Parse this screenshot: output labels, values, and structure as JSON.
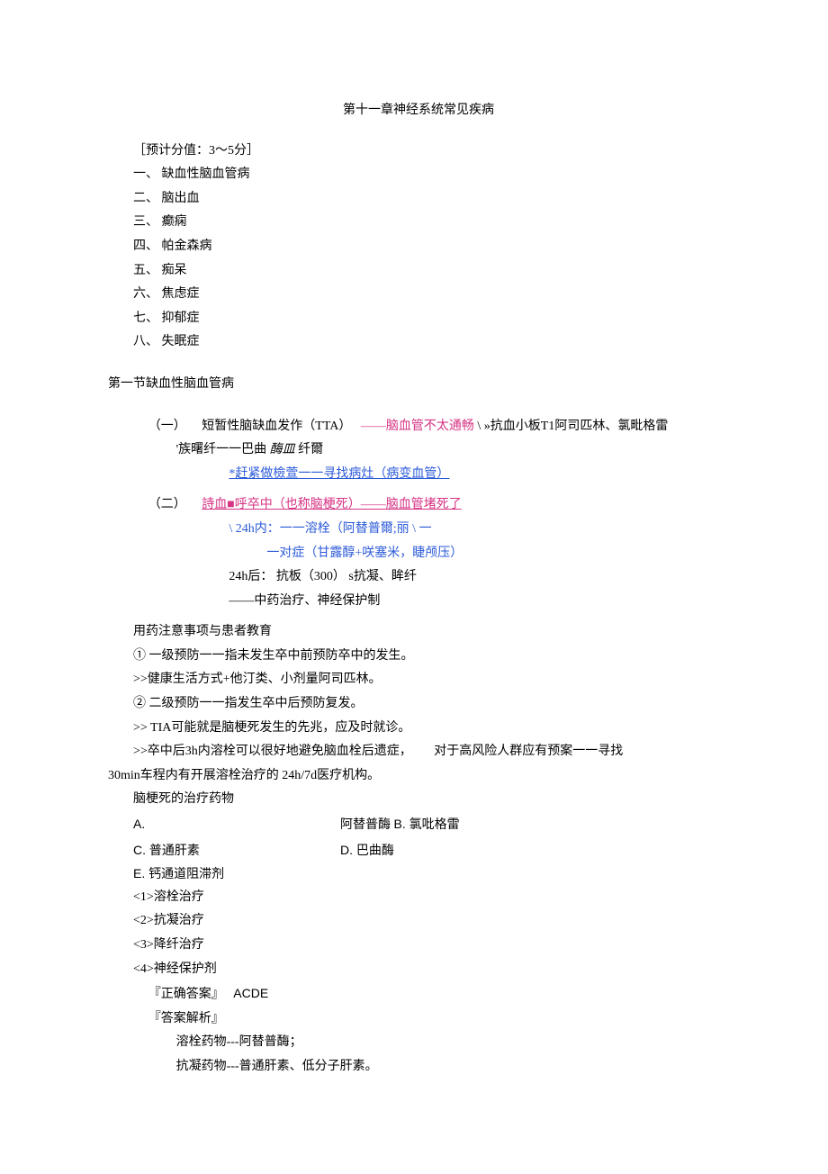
{
  "title": "第十一章神经系统常见疾病",
  "score_note": "［预计分值：3～5分］",
  "toc": [
    "一、 缺血性脑血管病",
    "二、 脑出血",
    "三、 癫痫",
    "四、 帕金森病",
    "五、 痴呆",
    "六、 焦虑症",
    "七、 抑郁症",
    "八、 失眠症"
  ],
  "section1_title": "第一节缺血性脑血管病",
  "sub1": {
    "label": "（一）",
    "head": "短暂性脑缺血发作（TTA）",
    "pink1": "——脑血管不太通畅",
    "tail1": " \\ »抗血小板T1阿司匹林、氯毗格雷",
    "line2a": "'族曙纤一一巴曲",
    "line2b": "酶皿",
    "line2c": "纤爾",
    "link": "*赶紧做檢萱一一寻找病灶（病变血管）"
  },
  "sub2": {
    "label": "（二）",
    "head": "詩血■呼卒中（也称脑梗死）——脑血管堵死了",
    "l1a": "\\ 24h内：一一溶栓（阿替普爾;丽 \\",
    "l1b": "  一",
    "l2": "一对症（甘露醇+咲塞米，睫颅压）",
    "l3": "24h后：  抗板（300）  s抗凝、眸纤",
    "l4": "——中药治疗、神经保护制"
  },
  "notes_title": "用药注意事项与患者教育",
  "notes": [
    "① 一级预防一一指未发生卒中前预防卒中的发生。",
    ">>健康生活方式+他汀类、小剂量阿司匹林。",
    "② 二级预防一一指发生卒中后预防复发。",
    ">> TIA可能就是脑梗死发生的先兆，应及时就诊。"
  ],
  "note_long_a": ">>卒中后3h内溶栓可以很好地避免脑血栓后遗症，",
  "note_long_b": "对于高风险人群应有预案一一寻找",
  "note_long_c": "30min车程内有开展溶栓治疗的 24h/7d医疗机构。",
  "q_title": "脑梗死的治疗药物",
  "opt_a": "A.",
  "opt_a2": "阿替普酶",
  "opt_b": "B. 氯吡格雷",
  "opt_c": "C. 普通肝素",
  "opt_d": "D. 巴曲酶",
  "opt_e": "E. 钙通道阻滞剂",
  "q_items": [
    "<1>溶栓治疗",
    "<2>抗凝治疗",
    "<3>降纤治疗",
    "<4>神经保护剂"
  ],
  "ans_label": "『正确答案』",
  "ans_value": "ACDE",
  "expl_label": "『答案解析』",
  "expl1": "溶栓药物---阿替普酶；",
  "expl2": "抗凝药物---普通肝素、低分子肝素。"
}
